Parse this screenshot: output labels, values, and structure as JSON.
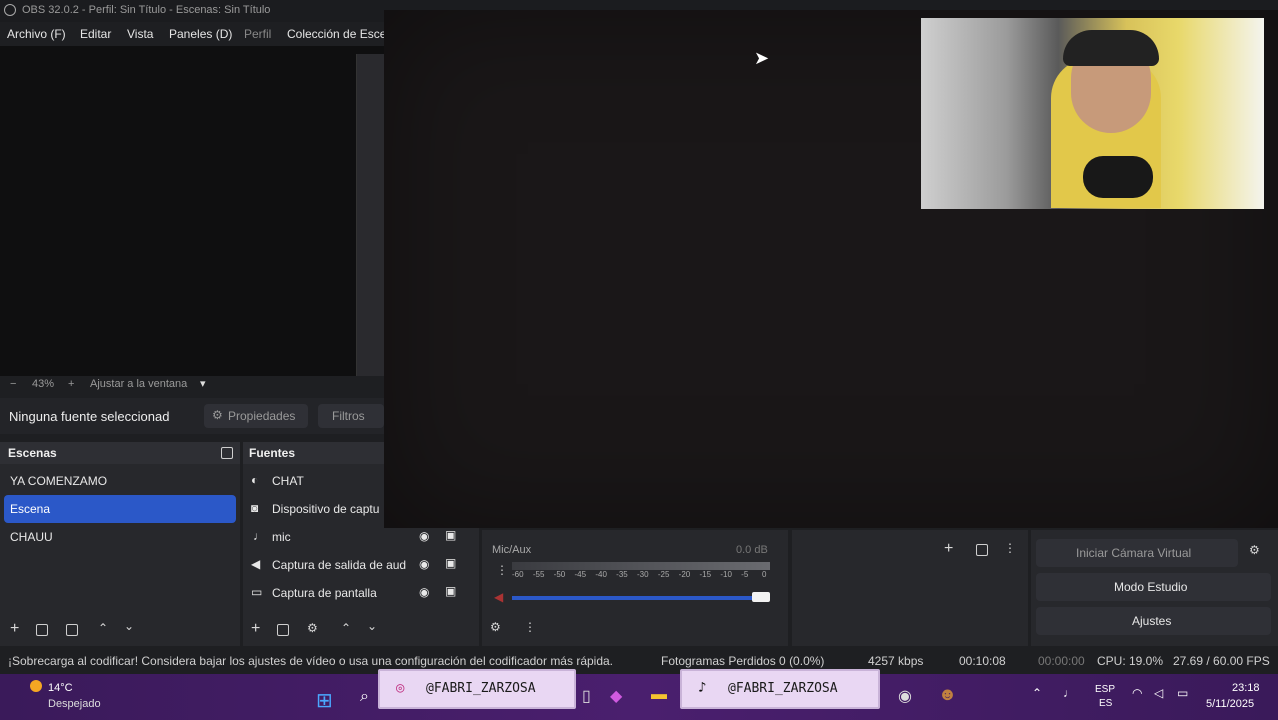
{
  "titlebar": {
    "title": "OBS 32.0.2 - Perfil: Sin Título - Escenas: Sin Título"
  },
  "menu": [
    "Archivo (F)",
    "Editar",
    "Vista",
    "Paneles (D)",
    "Perfil",
    "Colección de Esce"
  ],
  "zoom": {
    "minus": "−",
    "value": "43%",
    "plus": "+",
    "fit": "Ajustar a la ventana"
  },
  "source_bar": {
    "none": "Ninguna fuente seleccionad",
    "props": "Propiedades",
    "filters": "Filtros"
  },
  "scenes": {
    "header": "Escenas",
    "items": [
      "YA COMENZAMO",
      "Escena",
      "CHAUU"
    ],
    "selected_index": 1
  },
  "sources": {
    "header": "Fuentes",
    "items": [
      "CHAT",
      "Dispositivo de captu",
      "mic",
      "Captura de salida de aud",
      "Captura de pantalla"
    ]
  },
  "mixer": {
    "label": "Mic/Aux",
    "db": "0.0 dB",
    "ticks": [
      "-60",
      "-55",
      "-50",
      "-45",
      "-40",
      "-35",
      "-30",
      "-25",
      "-20",
      "-15",
      "-10",
      "-5",
      "0"
    ]
  },
  "controls": {
    "virtual_cam": "Iniciar Cámara Virtual",
    "studio": "Modo Estudio",
    "settings": "Ajustes"
  },
  "status": {
    "warning": "¡Sobrecarga al codificar! Considera bajar los ajustes de vídeo o usa una configuración del codificador más rápida.",
    "frames": "Fotogramas Perdidos 0 (0.0%)",
    "kbps": "4257 kbps",
    "stream_time": "00:10:08",
    "rec_time": "00:00:00",
    "cpu": "CPU: 19.0%",
    "fps": "27.69 / 60.00 FPS"
  },
  "taskbar": {
    "weather_temp": "14°C",
    "weather_desc": "Despejado",
    "instagram": "@FABRI_ZARZOSA",
    "tiktok": "@FABRI_ZARZOSA",
    "lang1": "ESP",
    "lang2": "ES",
    "time": "23:18",
    "date": "5/11/2025"
  },
  "colors": {
    "accent": "#2b58c8",
    "taskbar": "#4a1f6e"
  }
}
